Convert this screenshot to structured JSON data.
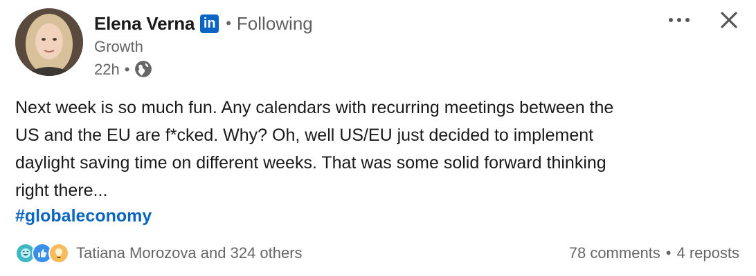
{
  "author": {
    "name": "Elena Verna",
    "network_badge": "in",
    "follow_status": "Following",
    "headline": "Growth",
    "timestamp": "22h",
    "visibility_icon": "globe-icon"
  },
  "actions": {
    "more_icon": "more-horizontal-icon",
    "close_icon": "close-icon"
  },
  "post": {
    "lines": [
      "Next week is so much fun. Any calendars with recurring meetings between the",
      "US and the EU are f*cked. Why? Oh, well US/EU just decided to implement",
      "daylight saving time on different weeks. That was some solid forward thinking",
      "right there..."
    ],
    "hashtag": "#globaleconomy"
  },
  "social": {
    "reaction_icons": [
      "funny-reaction-icon",
      "like-reaction-icon",
      "insightful-reaction-icon"
    ],
    "reactors_text": "Tatiana Morozova and 324 others",
    "comments": "78 comments",
    "reposts": "4 reposts"
  },
  "colors": {
    "brand": "#0a66c2",
    "text_primary": "#1a1a1a",
    "text_secondary": "#666666"
  }
}
